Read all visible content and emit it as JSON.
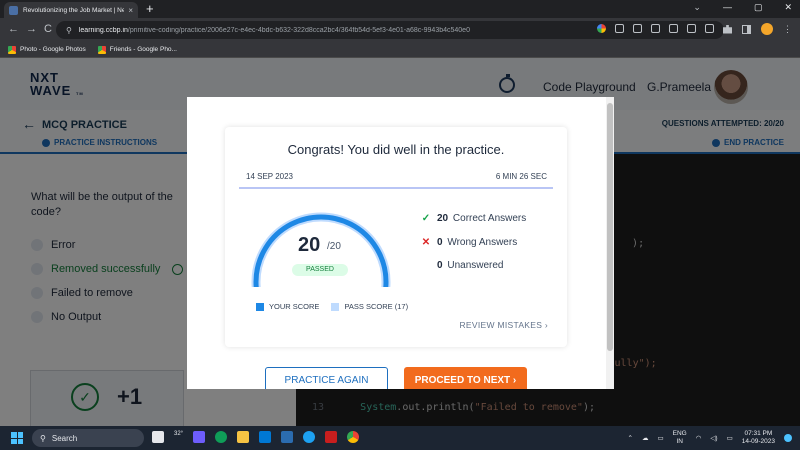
{
  "browser": {
    "tab_title": "Revolutionizing the Job Market | Ne",
    "tab_close": "×",
    "new_tab": "+",
    "window_controls": [
      "⌄",
      "—",
      "▢",
      "✕"
    ],
    "nav": {
      "back": "←",
      "forward": "→",
      "reload": "C"
    },
    "url_host": "learning.ccbp.in",
    "url_path": "/primitive-coding/practice/2006e27c-e4ec-4bdc-b632-322d8cca2bc4/364fb54d-5ef3-4e01-a68c-9943b4c540e0",
    "bookmarks": [
      "Photo - Google Photos",
      "Friends - Google Pho..."
    ]
  },
  "header": {
    "logo_line1": "NXT",
    "logo_line2": "WAVE",
    "logo_tm": "TM",
    "code_playground": "Code Playground",
    "user_name": "G.Prameela"
  },
  "subheader": {
    "title": "MCQ PRACTICE",
    "instructions": "PRACTICE INSTRUCTIONS",
    "attempted": "QUESTIONS ATTEMPTED: 20/20",
    "end_practice": "END PRACTICE"
  },
  "question": {
    "text": "What will be the output of the code?",
    "options": [
      "Error",
      "Removed successfully",
      "Failed to remove",
      "No Output"
    ],
    "correct_index": 1
  },
  "score_card": {
    "value": "+1"
  },
  "editor": {
    "lines": [
      {
        "n": "",
        "text": "   );"
      },
      {
        "n": "",
        "text": "                      ssfully\");"
      },
      {
        "n": "13",
        "cls": "System",
        "mid": ".out.println(",
        "str": "\"Failed to remove\"",
        "end": ");"
      }
    ]
  },
  "modal": {
    "title": "Congrats! You did well in the practice.",
    "date": "14 SEP 2023",
    "duration": "6 MIN 26 SEC",
    "score": "20",
    "total": "/20",
    "status": "PASSED",
    "stats": [
      {
        "mark": "✓",
        "count": "20",
        "label": "Correct Answers"
      },
      {
        "mark": "✕",
        "count": "0",
        "label": "Wrong Answers"
      },
      {
        "mark": "",
        "count": "0",
        "label": "Unanswered"
      }
    ],
    "legend_your": "YOUR SCORE",
    "legend_pass": "PASS SCORE (17)",
    "review": "REVIEW MISTAKES ›",
    "btn_again": "PRACTICE AGAIN",
    "btn_next": "PROCEED TO NEXT ›"
  },
  "chart_data": {
    "type": "gauge",
    "value": 20,
    "max": 20,
    "pass_score": 17
  },
  "colors": {
    "accent": "#1e6fbf",
    "gauge_score": "#1e88e5",
    "gauge_pass": "#bfdbfe",
    "proceed_button": "#f26b1d",
    "correct": "#16a34a",
    "wrong": "#dc2626",
    "unanswered": "#f59e0b"
  },
  "taskbar": {
    "search": "Search",
    "weather": "32°",
    "lang_line1": "ENG",
    "lang_line2": "IN",
    "time": "07:31 PM",
    "date": "14-09-2023"
  }
}
